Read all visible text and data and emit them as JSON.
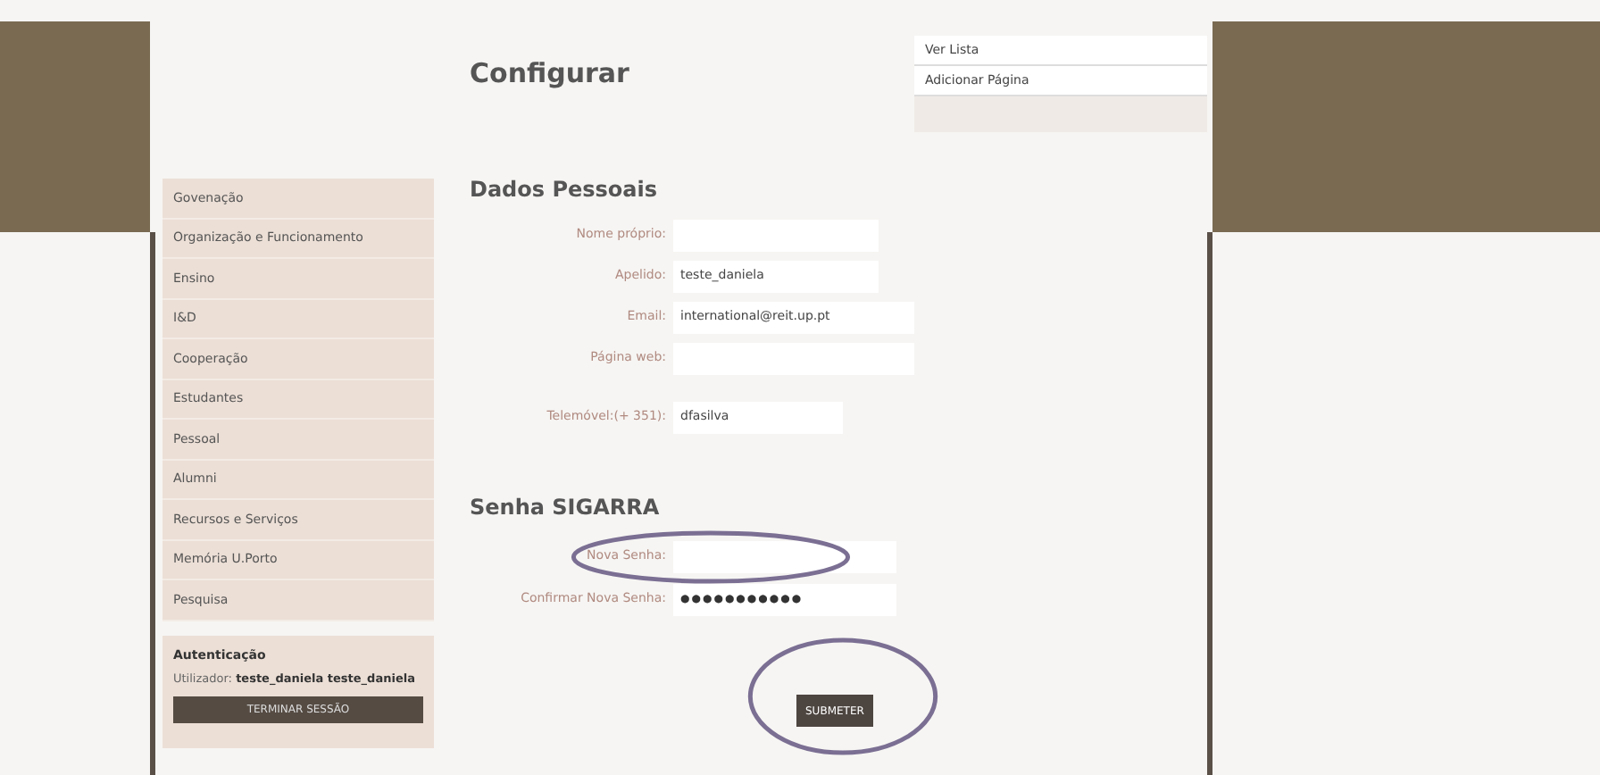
{
  "page_title": "Configurar",
  "sidebar": {
    "items": [
      {
        "label": "Govenação"
      },
      {
        "label": "Organização e Funcionamento"
      },
      {
        "label": "Ensino"
      },
      {
        "label": "I&D"
      },
      {
        "label": "Cooperação"
      },
      {
        "label": "Estudantes"
      },
      {
        "label": "Pessoal"
      },
      {
        "label": "Alumni"
      },
      {
        "label": "Recursos e Serviços"
      },
      {
        "label": "Memória U.Porto"
      },
      {
        "label": "Pesquisa"
      }
    ]
  },
  "auth": {
    "title": "Autenticação",
    "user_label": "Utilizador:",
    "user_name": "teste_daniela teste_daniela",
    "logout": "TERMINAR SESSÃO"
  },
  "right_menu": [
    "Ver Lista",
    "Adicionar Página"
  ],
  "personal": {
    "title": "Dados Pessoais",
    "fields": [
      {
        "label": "Nome próprio:"
      },
      {
        "label": "Apelido:",
        "value": "teste_daniela"
      },
      {
        "label": "Email:",
        "value": "international@reit.up.pt"
      },
      {
        "label": "Página web:"
      },
      {
        "label": "Telemóvel:(+ 351):",
        "value": "dfasilva"
      }
    ]
  },
  "password": {
    "title": "Senha SIGARRA",
    "fields": [
      {
        "label": "Nova Senha:",
        "circled": true
      },
      {
        "label": "Confirmar Nova Senha:",
        "value": "●●●●●●●●●●●",
        "circled": false
      }
    ]
  },
  "submit": {
    "label": "SUBMETER",
    "circled": true
  }
}
